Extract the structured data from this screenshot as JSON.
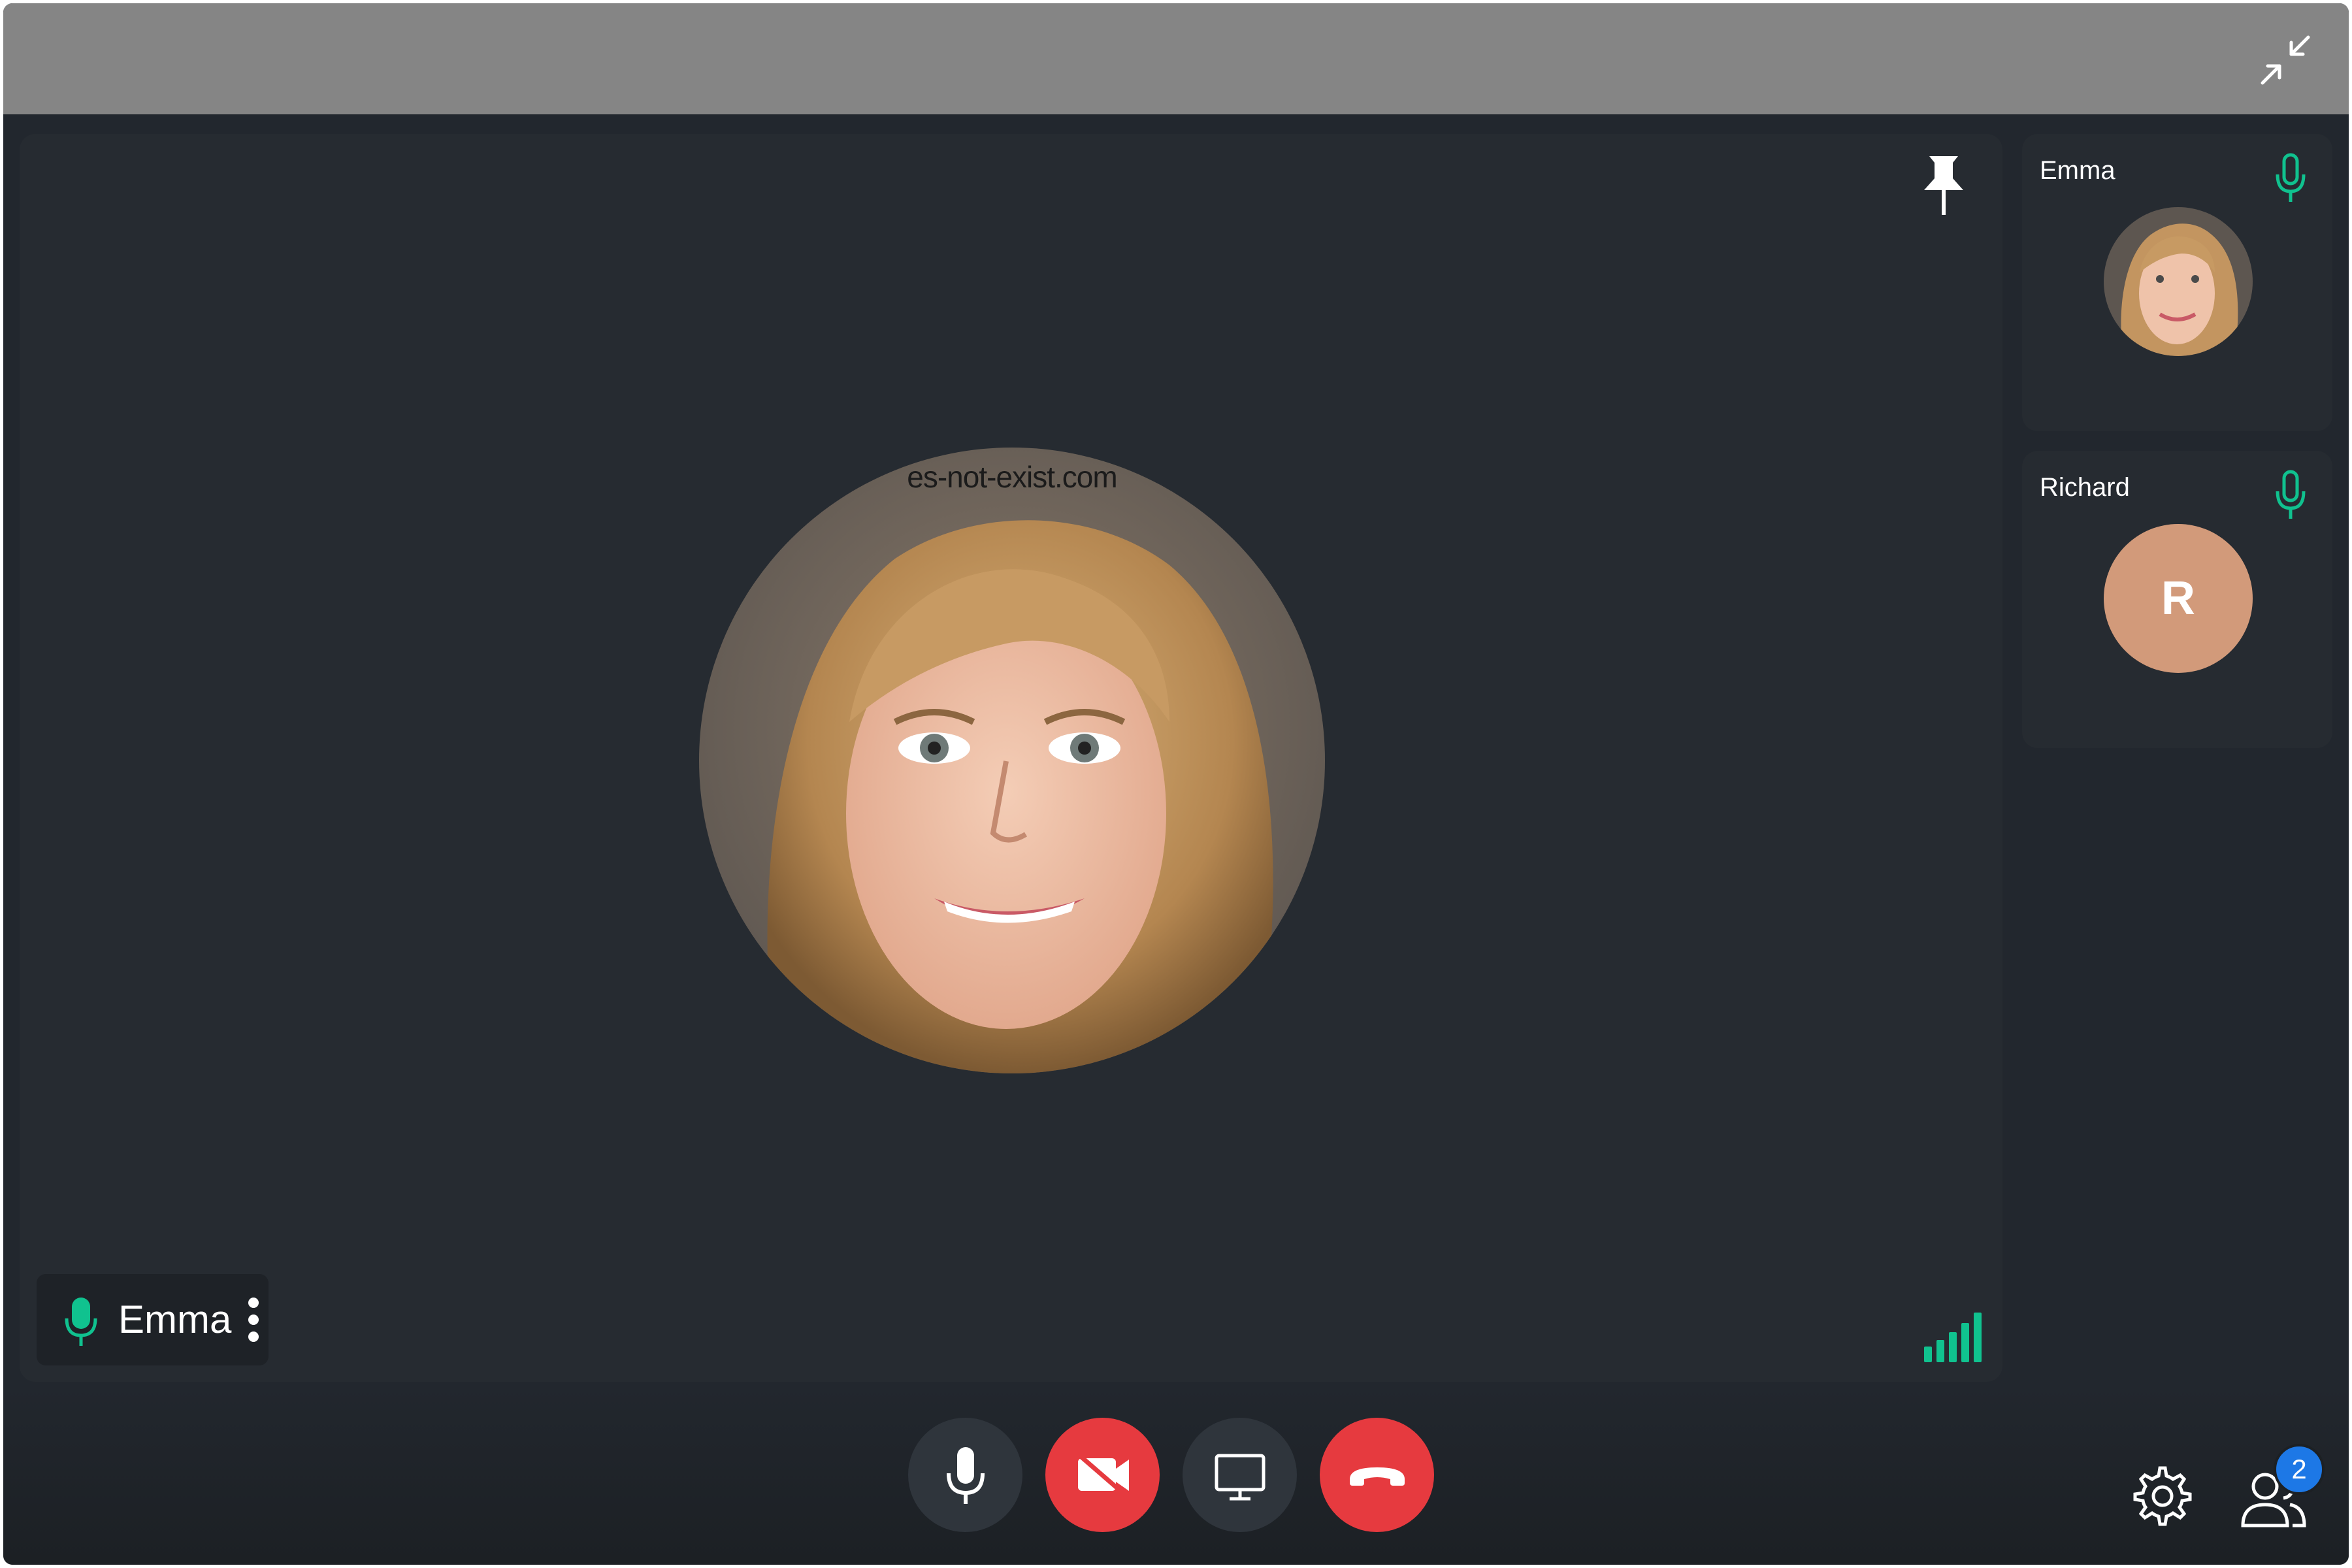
{
  "window": {
    "minimize_icon": "minimize-arrows-icon"
  },
  "stage": {
    "pin_icon": "pin-icon",
    "watermark": "es-not-exist.com",
    "speaker": {
      "name": "Emma",
      "mic_icon": "microphone-icon",
      "mic_color": "#10c28f",
      "more_icon": "more-vertical-icon"
    },
    "signal_icon": "signal-strength-icon",
    "signal_color": "#10c28f"
  },
  "participants": [
    {
      "name": "Emma",
      "avatar": "photo",
      "mic_icon": "microphone-icon"
    },
    {
      "name": "Richard",
      "avatar_initial": "R",
      "avatar_color": "#d29a7a",
      "mic_icon": "microphone-icon"
    }
  ],
  "controls": {
    "mic_icon": "microphone-icon",
    "camera_icon": "camera-off-icon",
    "screen_icon": "screen-share-icon",
    "hangup_icon": "hang-up-icon",
    "settings_icon": "gear-icon",
    "people_icon": "participants-icon",
    "people_count": "2",
    "danger_color": "#e63a3f",
    "badge_color": "#1d78e6"
  }
}
